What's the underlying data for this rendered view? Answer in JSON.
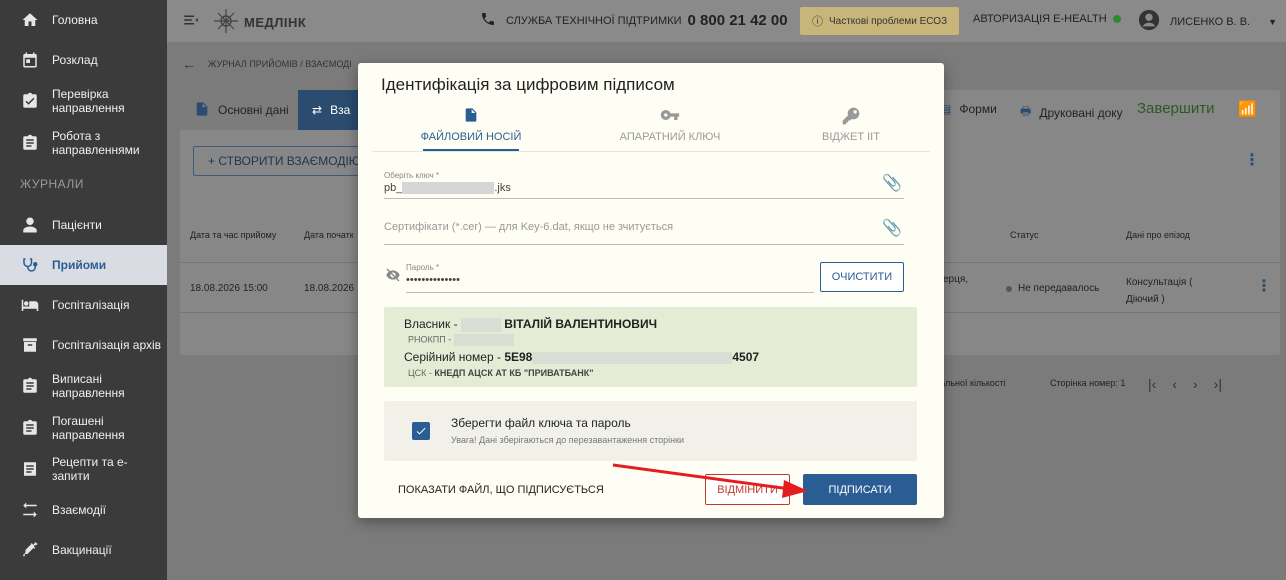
{
  "sidebar": {
    "items": [
      {
        "label": "Головна",
        "icon": "home-icon"
      },
      {
        "label": "Розклад",
        "icon": "calendar-icon"
      },
      {
        "label": "Перевірка направлення",
        "icon": "clipboard-check-icon"
      },
      {
        "label": "Робота з направленнями",
        "icon": "clipboard-icon"
      }
    ],
    "section_label": "ЖУРНАЛИ",
    "journal_items": [
      {
        "label": "Пацієнти",
        "icon": "person-icon"
      },
      {
        "label": "Прийоми",
        "icon": "stethoscope-icon",
        "active": true
      },
      {
        "label": "Госпіталізація",
        "icon": "bed-icon"
      },
      {
        "label": "Госпіталізація архів",
        "icon": "archive-icon"
      },
      {
        "label": "Виписані направлення",
        "icon": "clipboard-icon"
      },
      {
        "label": "Погашені направлення",
        "icon": "clipboard-icon"
      },
      {
        "label": "Рецепти та е-запити",
        "icon": "list-icon"
      },
      {
        "label": "Взаємодії",
        "icon": "swap-icon"
      },
      {
        "label": "Вакцинації",
        "icon": "syringe-icon"
      }
    ]
  },
  "topbar": {
    "logo_text": "МЕДЛІНК",
    "support_label": "СЛУЖБА ТЕХНІЧНОЇ ПІДТРИМКИ",
    "support_phone": "0 800 21 42 00",
    "ecoz_badge": "Часткові проблеми ЕСОЗ",
    "ehealth_label": "АВТОРИЗАЦІЯ E-HEALTH",
    "user_name": "ЛИСЕНКО В. В."
  },
  "main": {
    "breadcrumb": "ЖУРНАЛ ПРИЙОМІВ / ВЗАЄМОДІ",
    "tabs": {
      "basic": "Основні дані",
      "interactions": "Вза",
      "forms": "Форми",
      "printed": "Друковані доку",
      "finish": "Завершити"
    },
    "create_button": "+ СТВОРИТИ ВЗАЄМОДІЮ",
    "columns": {
      "date_time": "Дата та час прийому",
      "start": "Дата початк",
      "status": "Статус",
      "episode": "Дані про епізод"
    },
    "row": {
      "date_time": "18.08.2026 15:00",
      "start": "18.08.2026",
      "partial": "ерця,",
      "status": "Не передавалось",
      "episode_line1": "Консультація (",
      "episode_line2": "Діючий )"
    },
    "pager": {
      "total": "агальної кількості",
      "page": "Сторінка номер: 1"
    }
  },
  "modal": {
    "title": "Ідентифікація за цифровим підписом",
    "tabs": [
      "ФАЙЛОВИЙ НОСІЙ",
      "АПАРАТНИЙ КЛЮЧ",
      "ВІДЖЕТ ІІТ"
    ],
    "key_label": "Оберіть ключ *",
    "key_prefix": "pb_",
    "key_suffix": ".jks",
    "cert_placeholder": "Сертифікати (*.cer) — для Key-6.dat, якщо не зчитується",
    "password_label": "Пароль *",
    "password_value": "••••••••••••••",
    "clear_button": "ОЧИСТИТИ",
    "owner_label": "Власник -",
    "owner_name": "ВІТАЛІЙ ВАЛЕНТИНОВИЧ",
    "rnokpp_label": "РНОКПП -",
    "serial_label": "Серійний номер -",
    "serial_prefix": "5E98",
    "serial_suffix": "4507",
    "csk_label": "ЦСК -",
    "csk_value": "КНЕДП АЦСК АТ КБ \"ПРИВАТБАНК\"",
    "save_title": "Зберегти файл ключа та пароль",
    "save_note": "Увага! Дані зберігаються до перезавантаження сторінки",
    "show_file": "ПОКАЗАТИ ФАЙЛ, ЩО ПІДПИСУЄТЬСЯ",
    "cancel_button": "ВІДМІНИТИ",
    "sign_button": "ПІДПИСАТИ"
  },
  "colors": {
    "accent": "#2b5d95",
    "sidebar_bg": "#3b3b3b",
    "owner_box_bg": "#e5ecd6",
    "annotation_arrow": "#e41e1e"
  }
}
